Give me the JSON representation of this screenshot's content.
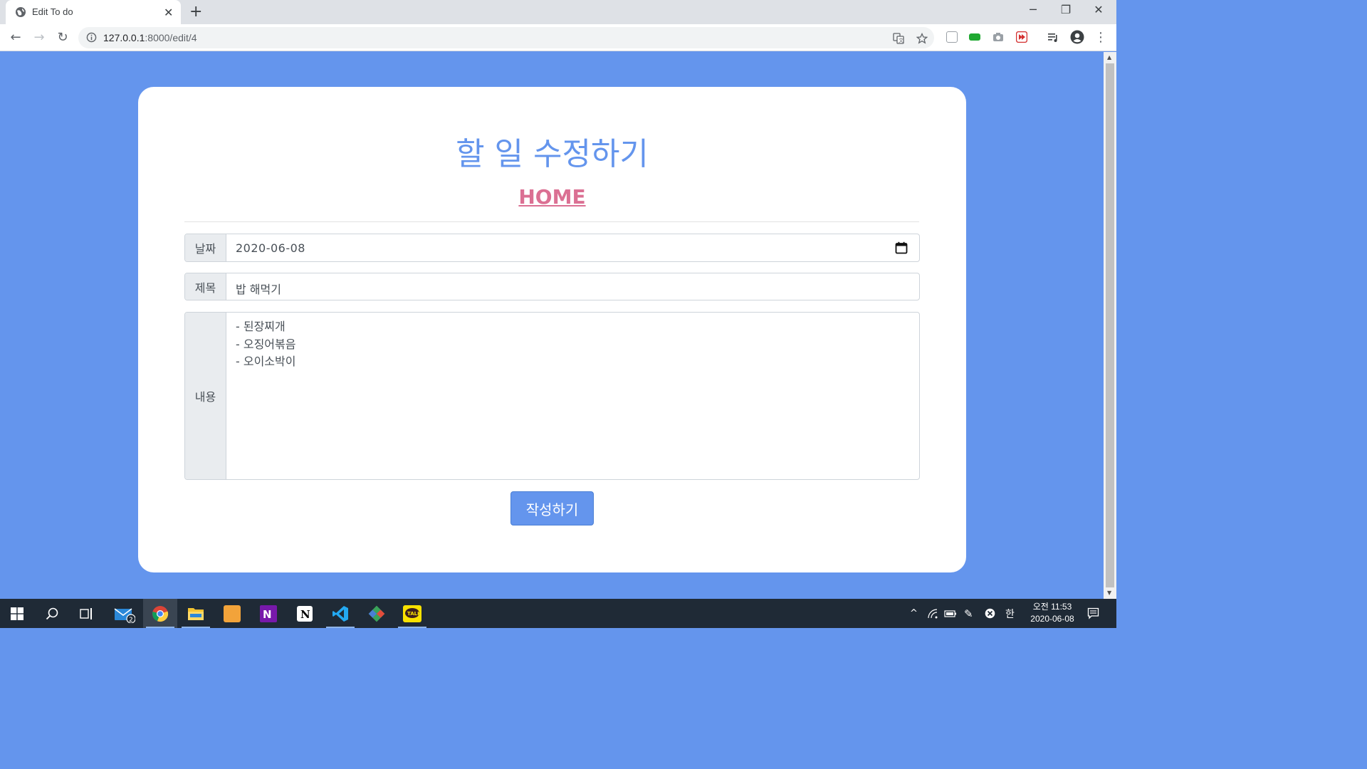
{
  "browser": {
    "tab_title": "Edit To do",
    "url_host": "127.0.0.1",
    "url_rest": ":8000/edit/4"
  },
  "page": {
    "heading": "할 일 수정하기",
    "home_link": "HOME",
    "date_label": "날짜",
    "date_value": "2020-06-08",
    "title_label": "제목",
    "title_value": "밥 해먹기",
    "content_label": "내용",
    "content_value": "- 된장찌개\n- 오징어볶음\n- 오이소박이",
    "submit_label": "작성하기"
  },
  "taskbar": {
    "mail_badge": "2",
    "ime": "한",
    "clock_period_time": "오전 11:53",
    "clock_date": "2020-06-08"
  },
  "colors": {
    "page_bg": "#6495ed",
    "heading": "#6495ed",
    "home_link": "#db7093",
    "button": "#6495ed"
  }
}
